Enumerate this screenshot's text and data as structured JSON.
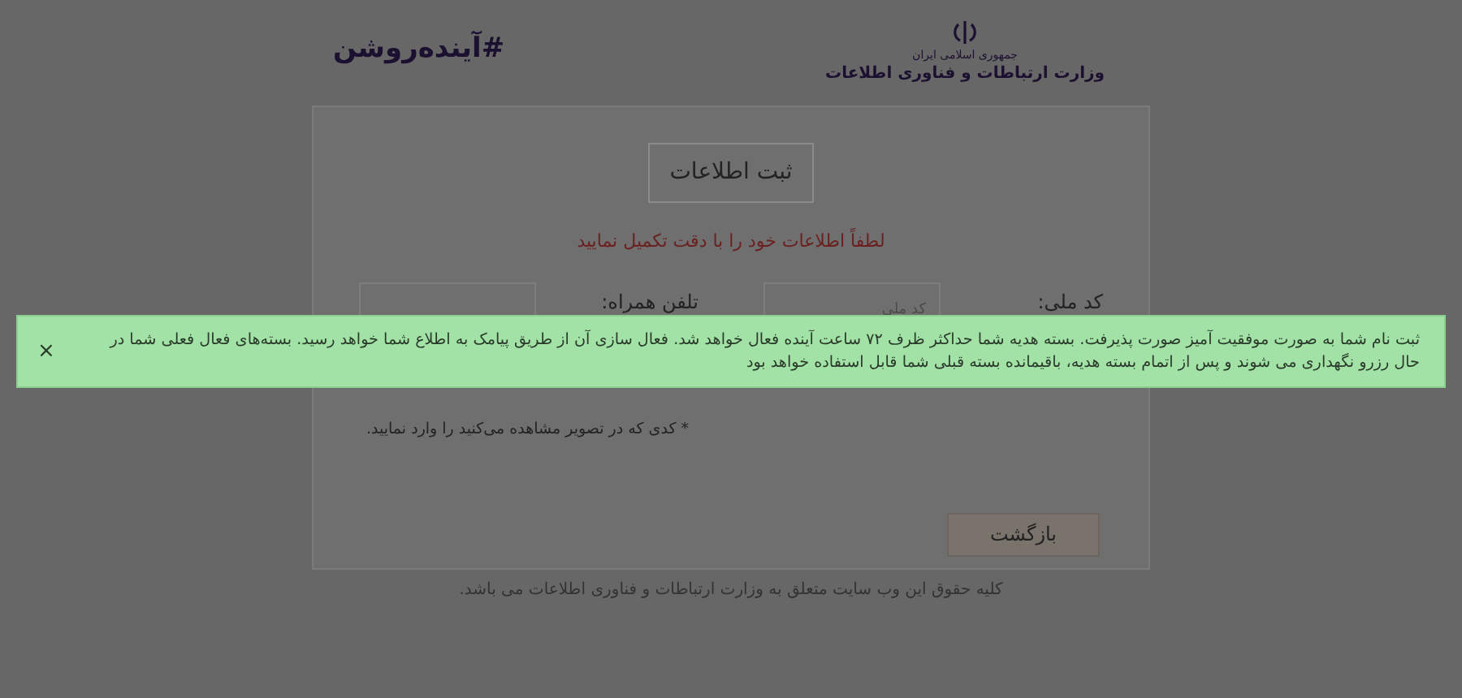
{
  "header": {
    "ministry_line_1": "جمهوری اسلامی ایران",
    "ministry_line_2": "وزارت ارتباطات و فناوری اطلاعات",
    "slogan": "#آینده‌روشن"
  },
  "form": {
    "title": "ثبت اطلاعات",
    "instruction": "لطفاً اطلاعات خود را با دقت تکمیل نمایید",
    "fields": [
      {
        "label": "کد ملی:",
        "placeholder": "کد ملی"
      },
      {
        "label": "تلفن همراه:"
      }
    ],
    "captcha_note": "* کدی که در تصویر مشاهده می‌کنید را وارد نمایید.",
    "back_button": "بازگشت"
  },
  "alert": {
    "message": "ثبت نام شما به صورت موفقیت آمیز صورت پذیرفت. بسته هدیه شما حداکثر ظرف ۷۲ ساعت آینده فعال خواهد شد. فعال سازی آن از طریق پیامک به اطلاع شما خواهد رسید. بسته‌های فعال فعلی شما در حال رزرو نگهداری می شوند و پس از اتمام بسته هدیه، باقیمانده بسته قبلی شما قابل استفاده خواهد بود",
    "close": "×"
  },
  "footer": "کلیه حقوق این وب سایت متعلق به وزارت ارتباطات و فناوری اطلاعات می باشد."
}
